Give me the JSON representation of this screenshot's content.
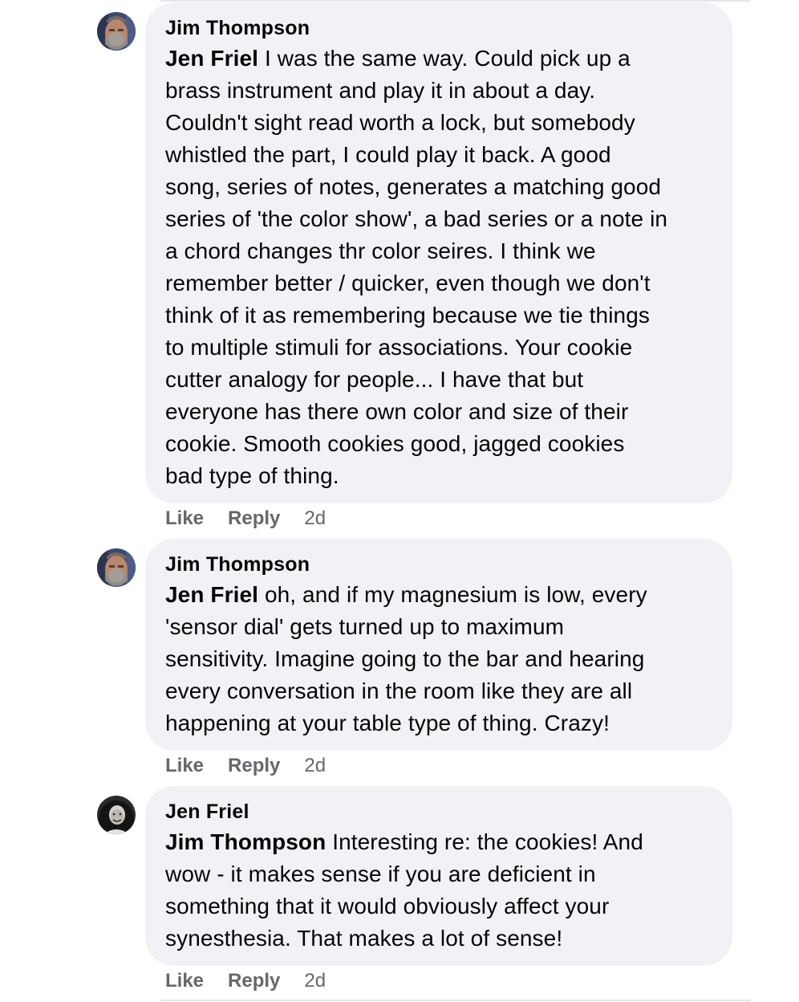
{
  "comments": [
    {
      "author": "Jim Thompson",
      "mention": "Jen Friel",
      "lines": [
        " I was the same way. Could pick up a",
        "brass instrument and play it in about a day.",
        "Couldn't sight read worth a lock, but somebody",
        "whistled the part, I could play it back. A good",
        "song, series of notes, generates a matching good",
        "series of 'the color show', a bad series or a note in",
        "a chord changes thr color seires. I think we",
        "remember better / quicker, even though we don't",
        "think of it as remembering because we tie things",
        "to multiple stimuli for associations. Your cookie",
        "cutter analogy for people... I have that but",
        "everyone has there own color and size of their",
        "cookie. Smooth cookies good, jagged cookies",
        "bad type of thing."
      ],
      "like": "Like",
      "reply": "Reply",
      "time": "2d"
    },
    {
      "author": "Jim Thompson",
      "mention": "Jen Friel",
      "lines": [
        " oh, and if my magnesium is low, every",
        "'sensor dial' gets turned up to maximum",
        "sensitivity. Imagine going to the bar and hearing",
        "every conversation in the room like they are all",
        "happening at your table type of thing. Crazy!"
      ],
      "like": "Like",
      "reply": "Reply",
      "time": "2d"
    },
    {
      "author": "Jen Friel",
      "mention": "Jim Thompson",
      "lines": [
        " Interesting re: the cookies! And",
        "wow - it makes sense if you are deficient in",
        "something that it would obviously affect your",
        "synesthesia. That makes a lot of sense!"
      ],
      "like": "Like",
      "reply": "Reply",
      "time": "2d"
    }
  ]
}
